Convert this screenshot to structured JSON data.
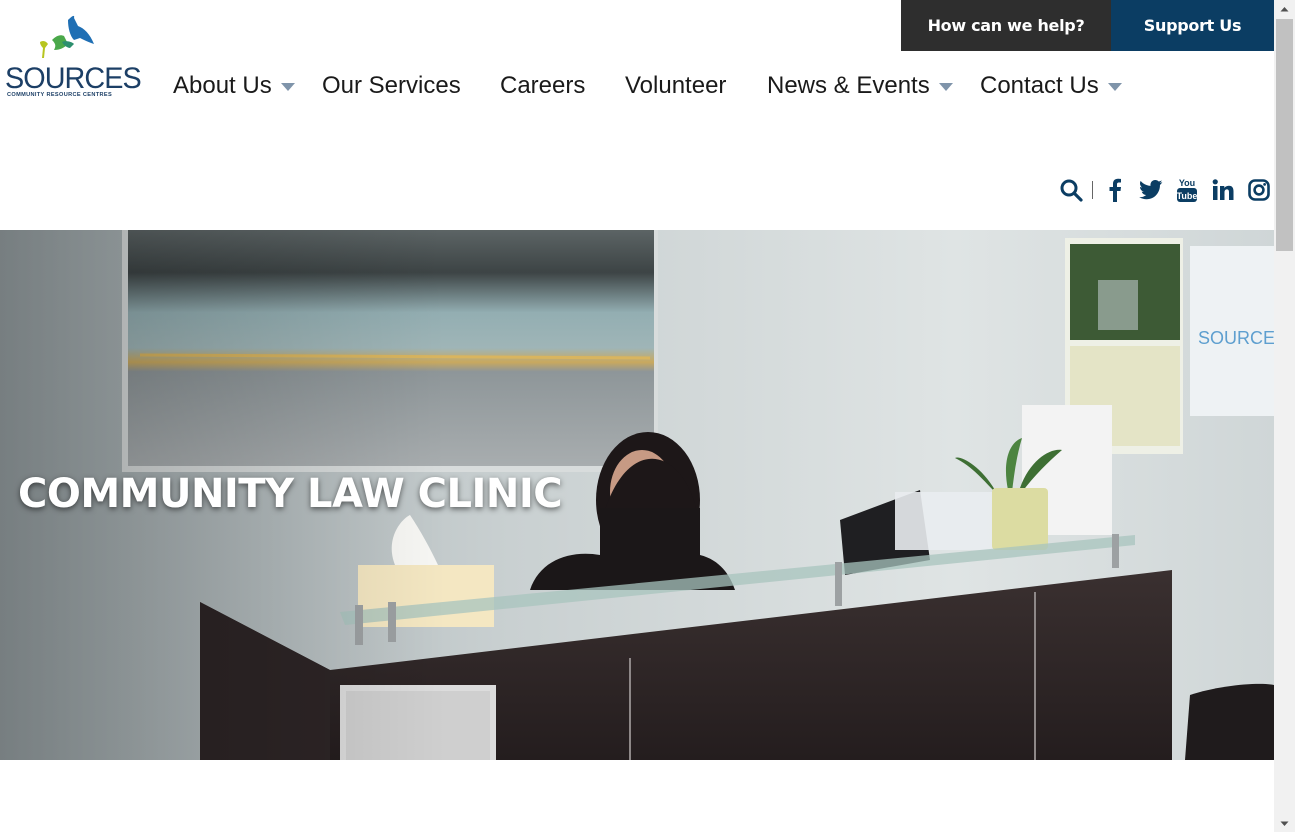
{
  "utility": {
    "help_label": "How can we help?",
    "support_label": "Support Us"
  },
  "logo": {
    "name": "SOURCES",
    "tagline": "COMMUNITY RESOURCE CENTRES"
  },
  "nav": {
    "items": [
      {
        "label": "About Us",
        "has_dropdown": true
      },
      {
        "label": "Our Services",
        "has_dropdown": false
      },
      {
        "label": "Careers",
        "has_dropdown": false
      },
      {
        "label": "Volunteer",
        "has_dropdown": false
      },
      {
        "label": "News & Events",
        "has_dropdown": true
      },
      {
        "label": "Contact Us",
        "has_dropdown": true
      }
    ]
  },
  "social": {
    "icons": [
      "search-icon",
      "facebook-icon",
      "twitter-icon",
      "youtube-icon",
      "linkedin-icon",
      "instagram-icon"
    ],
    "youtube_text_top": "You",
    "youtube_text_bottom": "Tube"
  },
  "hero": {
    "title": "COMMUNITY LAW CLINIC"
  },
  "colors": {
    "brand_navy": "#0b3d63",
    "dark_button": "#2e2e2e",
    "caret": "#7f94aa"
  }
}
